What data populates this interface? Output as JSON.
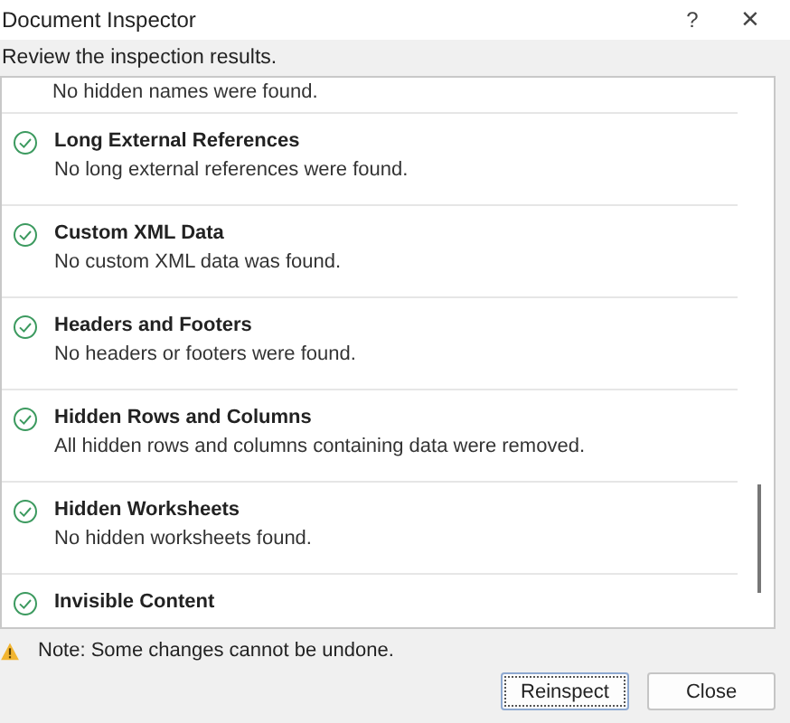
{
  "window": {
    "title": "Document Inspector",
    "help": "?",
    "close": "×"
  },
  "instruction": "Review the inspection results.",
  "results": [
    {
      "description": "No hidden names were found."
    },
    {
      "title": "Long External References",
      "description": "No long external references were found."
    },
    {
      "title": "Custom XML Data",
      "description": "No custom XML data was found."
    },
    {
      "title": "Headers and Footers",
      "description": "No headers or footers were found."
    },
    {
      "title": "Hidden Rows and Columns",
      "description": "All hidden rows and columns containing data were removed."
    },
    {
      "title": "Hidden Worksheets",
      "description": "No hidden worksheets found."
    },
    {
      "title": "Invisible Content"
    }
  ],
  "note": "Note: Some changes cannot be undone.",
  "buttons": [
    {
      "label": "Reinspect",
      "focused": true
    },
    {
      "label": "Close",
      "focused": false
    }
  ]
}
